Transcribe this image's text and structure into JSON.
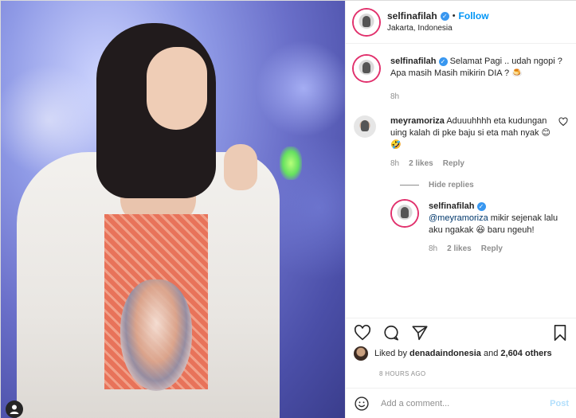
{
  "post": {
    "author": "selfinafilah",
    "follow_label": "Follow",
    "dot": "•",
    "location": "Jakarta, Indonesia",
    "more_label": "···"
  },
  "caption": {
    "user": "selfinafilah",
    "text": "Selamat Pagi .. udah ngopi ? Apa masih Masih mikirin DIA ? 🍮",
    "time": "8h"
  },
  "comments": [
    {
      "user": "meyramoriza",
      "text": "Aduuuhhhh eta kudungan uing kalah di pke baju si eta mah nyak 😊🤣",
      "time": "8h",
      "likes": "2 likes",
      "reply_label": "Reply"
    }
  ],
  "hide_replies_label": "Hide replies",
  "replies": [
    {
      "user": "selfinafilah",
      "mention": "@meyramoriza",
      "text": " mikir sejenak lalu aku ngakak 😆 baru ngeuh!",
      "time": "8h",
      "likes": "2 likes",
      "reply_label": "Reply"
    }
  ],
  "likes": {
    "prefix": "Liked by ",
    "user": "denadaindonesia",
    "middle": " and ",
    "count": "2,604 others"
  },
  "time_ago": "8 HOURS AGO",
  "add_comment": {
    "placeholder": "Add a comment...",
    "post_label": "Post"
  },
  "photo_overlay_icon": "user-tag-icon",
  "colors": {
    "link_blue": "#0095f6",
    "verified_blue": "#3897f0",
    "story_ring": "#e1306c",
    "post_disabled": "#b2dffc"
  }
}
